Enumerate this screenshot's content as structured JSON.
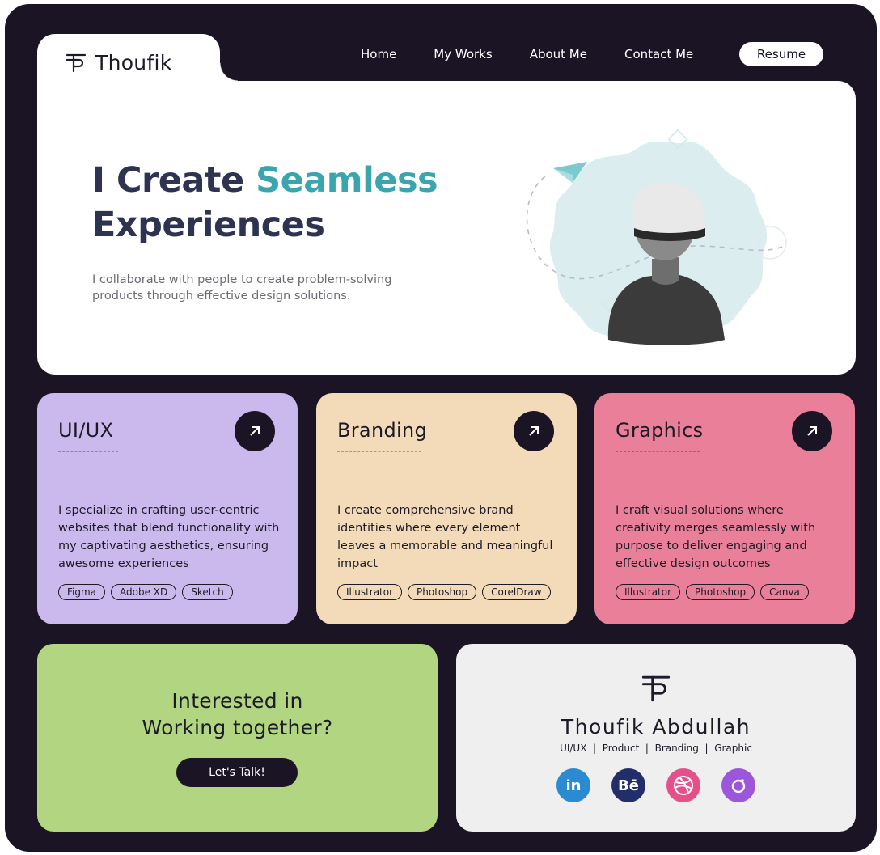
{
  "header": {
    "brand": "Thoufik",
    "nav": [
      "Home",
      "My Works",
      "About Me",
      "Contact Me"
    ],
    "resume_label": "Resume"
  },
  "hero": {
    "title_part1": "I Create ",
    "title_accent": "Seamless",
    "title_part2": "Experiences",
    "subtitle": "I collaborate with people to create problem-solving products through effective design solutions."
  },
  "services": [
    {
      "title": "UI/UX",
      "desc": "I specialize in crafting user-centric websites that blend functionality with my captivating aesthetics, ensuring awesome experiences",
      "tags": [
        "Figma",
        "Adobe XD",
        "Sketch"
      ]
    },
    {
      "title": "Branding",
      "desc": "I create comprehensive brand identities where every element leaves a memorable and meaningful impact",
      "tags": [
        "Illustrator",
        "Photoshop",
        "CorelDraw"
      ]
    },
    {
      "title": "Graphics",
      "desc": "I craft visual solutions where creativity merges seamlessly with purpose to deliver engaging and effective design outcomes",
      "tags": [
        "Illustrator",
        "Photoshop",
        "Canva"
      ]
    }
  ],
  "cta": {
    "line1": "Interested in",
    "line2": "Working together?",
    "button": "Let's Talk!"
  },
  "profile": {
    "name": "Thoufik Abdullah",
    "roles": "UI/UX  |  Product  |  Branding  |  Graphic",
    "socials": [
      {
        "icon": "linkedin-icon",
        "label": "in"
      },
      {
        "icon": "behance-icon",
        "label": "Bē"
      },
      {
        "icon": "dribbble-icon",
        "label": ""
      },
      {
        "icon": "instagram-icon",
        "label": ""
      }
    ]
  },
  "colors": {
    "background": "#1b1424",
    "accent": "#3aa5ad",
    "uiux_card": "#cbb9ee",
    "branding_card": "#f3dbb9",
    "graphics_card": "#e97f99",
    "cta_card": "#b2d582"
  }
}
